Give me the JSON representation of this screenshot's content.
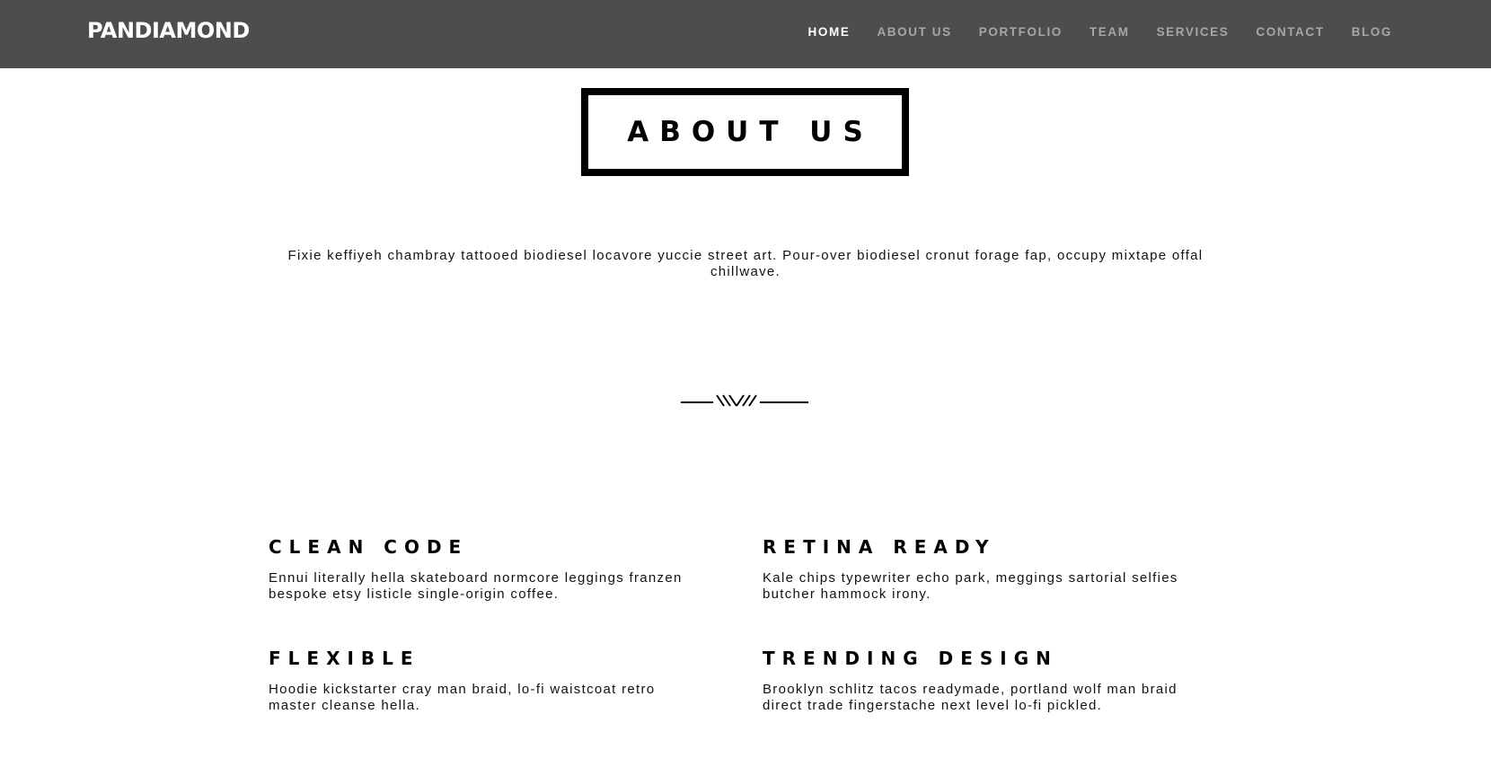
{
  "brand": "PANDIAMOND",
  "nav": {
    "items": [
      "HOME",
      "ABOUT US",
      "PORTFOLIO",
      "TEAM",
      "SERVICES",
      "CONTACT",
      "BLOG"
    ],
    "active": "HOME"
  },
  "section": {
    "title": "ABOUT US",
    "intro": "Fixie keffiyeh chambray tattooed biodiesel locavore yuccie street art. Pour-over biodiesel cronut forage fap, occupy mixtape offal chillwave."
  },
  "divider_icon": "ornamental-divider-icon",
  "features": [
    {
      "title": "CLEAN CODE",
      "text": "Ennui literally hella skateboard normcore leggings franzen bespoke etsy listicle single-origin coffee."
    },
    {
      "title": "RETINA READY",
      "text": "Kale chips typewriter echo park, meggings sartorial selfies butcher hammock irony."
    },
    {
      "title": "FLEXIBLE",
      "text": "Hoodie kickstarter cray man braid, lo-fi waistcoat retro master cleanse hella."
    },
    {
      "title": "TRENDING DESIGN",
      "text": "Brooklyn schlitz tacos readymade, portland wolf man braid direct trade fingerstache next level lo-fi pickled."
    }
  ],
  "colors": {
    "navbar_bg": "#4d4d4d",
    "nav_active": "#ffffff",
    "nav_inactive": "#a6a6a6",
    "text": "#111111"
  }
}
